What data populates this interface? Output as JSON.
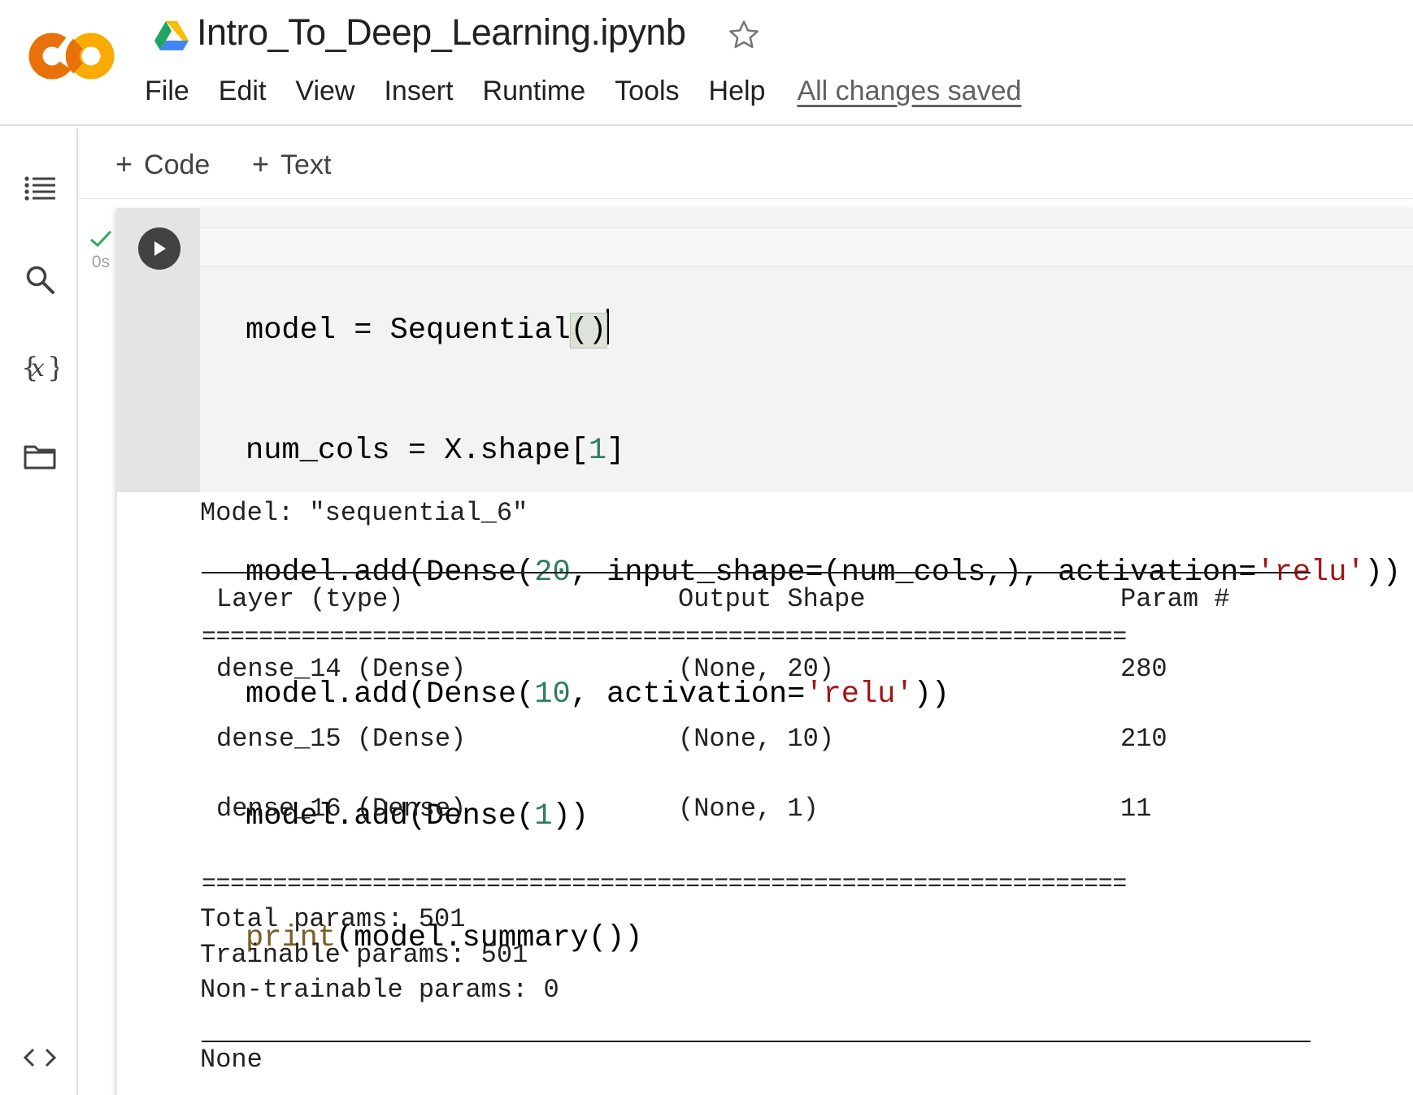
{
  "app": {
    "name": "Colab",
    "notebook_title": "Intro_To_Deep_Learning.ipynb",
    "save_status": "All changes saved",
    "menu": [
      "File",
      "Edit",
      "View",
      "Insert",
      "Runtime",
      "Tools",
      "Help"
    ]
  },
  "toolbar": {
    "add_code": "Code",
    "add_text": "Text"
  },
  "sidebar": {
    "icons": [
      "table-of-contents-icon",
      "search-icon",
      "variables-icon",
      "files-icon",
      "code-snippets-icon"
    ]
  },
  "cell": {
    "exec_time": "0s",
    "status": "success",
    "code_lines": [
      "model = Sequential()",
      "num_cols = X.shape[1]",
      "model.add(Dense(20, input_shape=(num_cols,), activation='relu'))",
      "model.add(Dense(10, activation='relu'))",
      "model.add(Dense(1))",
      "print(model.summary())"
    ],
    "code_parts": {
      "l1": {
        "a": "model = Sequential",
        "b": "()"
      },
      "l2": {
        "a": "num_cols = X.shape[",
        "n": "1",
        "c": "]"
      },
      "l3": {
        "a": "model.add(Dense(",
        "n": "20",
        "b": ", input_shape=(num_cols,), activation=",
        "s": "'relu'",
        "c": "))"
      },
      "l4": {
        "a": "model.add(Dense(",
        "n": "10",
        "b": ", activation=",
        "s": "'relu'",
        "c": "))"
      },
      "l5": {
        "a": "model.add(Dense(",
        "n": "1",
        "c": "))"
      },
      "l6": {
        "f": "print",
        "c": "(model.summary())"
      }
    }
  },
  "output": {
    "model_line": "Model: \"sequential_6\"",
    "headers": {
      "layer": "Layer (type)",
      "shape": "Output Shape",
      "params": "Param #"
    },
    "rows": [
      {
        "layer": "dense_14 (Dense)",
        "shape": "(None, 20)",
        "params": "280"
      },
      {
        "layer": "dense_15 (Dense)",
        "shape": "(None, 10)",
        "params": "210"
      },
      {
        "layer": "dense_16 (Dense)",
        "shape": "(None, 1)",
        "params": "11"
      }
    ],
    "separator": "=================================================================",
    "total": "Total params: 501",
    "trainable": "Trainable params: 501",
    "non_trainable": "Non-trainable params: 0",
    "result": "None"
  },
  "colors": {
    "logo_orange": "#F9AB00",
    "logo_dark_orange": "#E8710A",
    "check_green": "#34A853",
    "number_green": "#2E7D5B",
    "string_red": "#A31515",
    "function_brown": "#795E26"
  }
}
